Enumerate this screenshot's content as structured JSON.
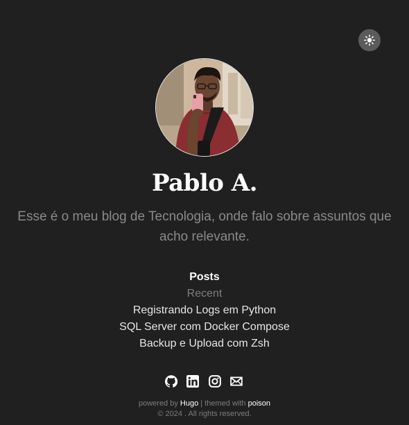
{
  "theme_toggle": {
    "icon": "sun-icon"
  },
  "profile": {
    "name": "Pablo A.",
    "tagline": "Esse é o meu blog de Tecnologia, onde falo sobre assuntos que acho relevante."
  },
  "nav": {
    "posts_label": "Posts",
    "recent_label": "Recent",
    "recent_posts": [
      "Registrando Logs em Python",
      "SQL Server com Docker Compose",
      "Backup e Upload com Zsh"
    ]
  },
  "socials": {
    "icons": [
      "github-icon",
      "linkedin-icon",
      "instagram-icon",
      "email-icon"
    ]
  },
  "footer": {
    "powered_by": "powered by",
    "hugo": "Hugo",
    "separator": "|",
    "themed_with": "themed with",
    "poison": "poison",
    "copyright": "© 2024 . All rights reserved."
  },
  "colors": {
    "background": "#202020",
    "toggle_bg": "#5b5b5b",
    "muted_text": "#8a8a8a"
  }
}
